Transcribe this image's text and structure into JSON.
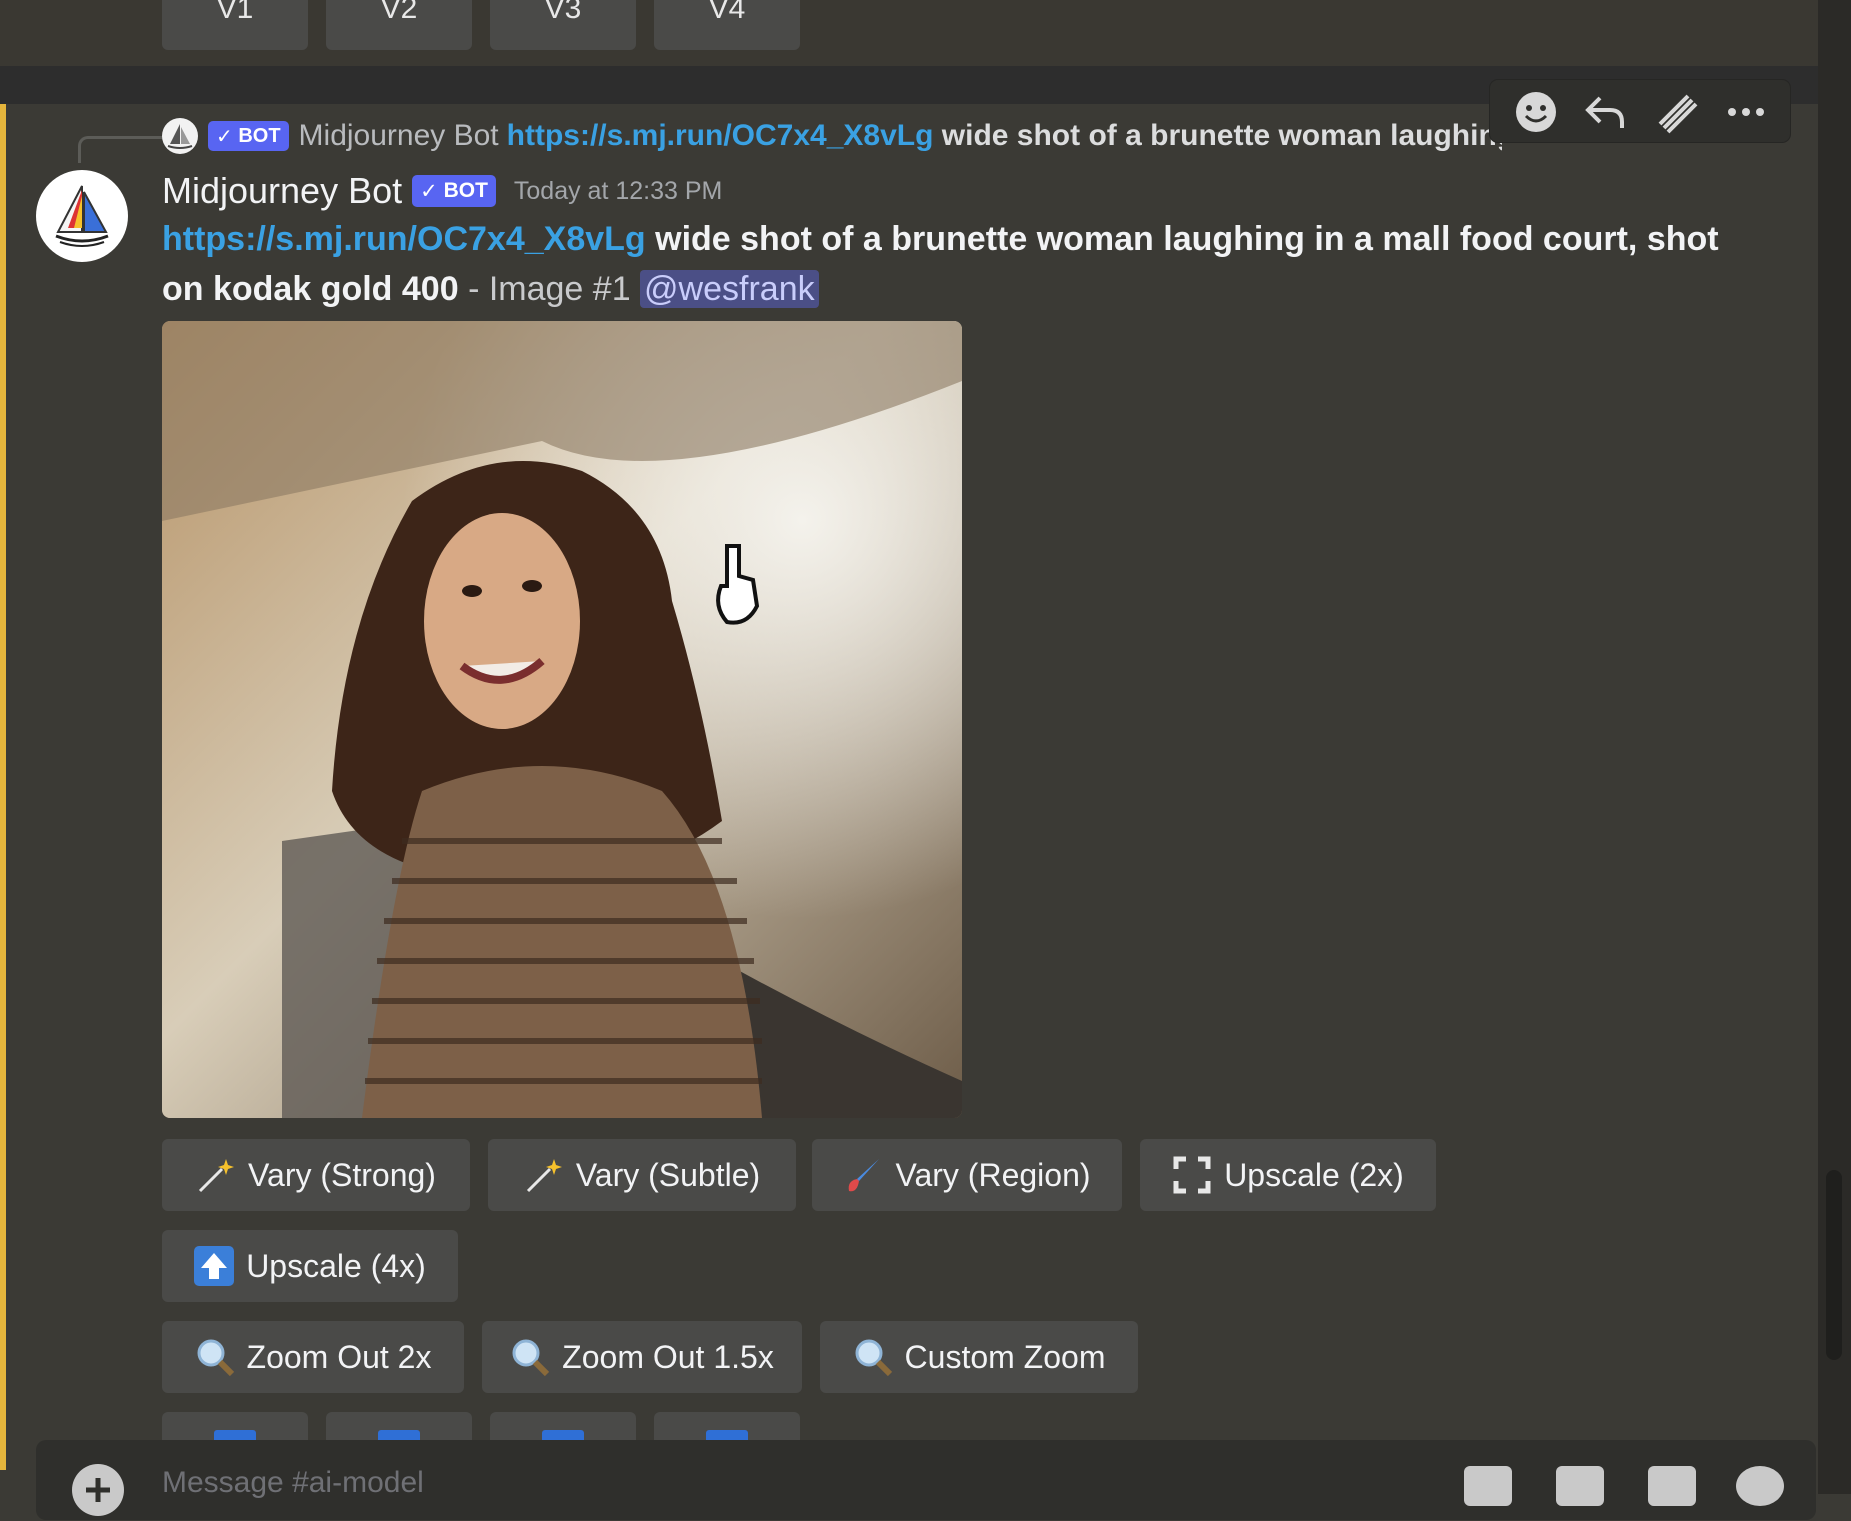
{
  "previous_message": {
    "variation_buttons": [
      "V1",
      "V2",
      "V3",
      "V4"
    ]
  },
  "hover_toolbar": {
    "icons": [
      "add-reaction-icon",
      "reply-icon",
      "forward-icon",
      "more-options-icon"
    ]
  },
  "reply_preview": {
    "author": "Midjourney Bot",
    "bot_tag": "BOT",
    "link": "https://s.mj.run/OC7x4_X8vLg",
    "text": "wide shot of a brunette woman laughing in a mall"
  },
  "message": {
    "author": "Midjourney Bot",
    "bot_tag": "BOT",
    "timestamp": "Today at 12:33 PM",
    "link": "https://s.mj.run/OC7x4_X8vLg",
    "prompt_bold": "wide shot of a brunette woman laughing in a mall food court, shot on kodak gold 400",
    "suffix": " - Image #1 ",
    "mention": "@wesfrank"
  },
  "image": {
    "description_icon": "generated-image"
  },
  "actions": {
    "row1": [
      {
        "label": "Vary (Strong)",
        "icon": "magic-wand-icon"
      },
      {
        "label": "Vary (Subtle)",
        "icon": "magic-wand-icon"
      },
      {
        "label": "Vary (Region)",
        "icon": "paintbrush-icon"
      },
      {
        "label": "Upscale (2x)",
        "icon": "expand-icon"
      }
    ],
    "row2": [
      {
        "label": "Upscale (4x)",
        "icon": "up-arrow-icon"
      }
    ],
    "row3": [
      {
        "label": "Zoom Out 2x",
        "icon": "magnifier-icon"
      },
      {
        "label": "Zoom Out 1.5x",
        "icon": "magnifier-icon"
      },
      {
        "label": "Custom Zoom",
        "icon": "magnifier-icon"
      }
    ]
  },
  "composer": {
    "placeholder": "Message #ai-model"
  },
  "colors": {
    "accent_bar": "#e5b53c",
    "link": "#3aa1e3",
    "bot_tag": "#5865f2",
    "button": "#4a4a48"
  }
}
